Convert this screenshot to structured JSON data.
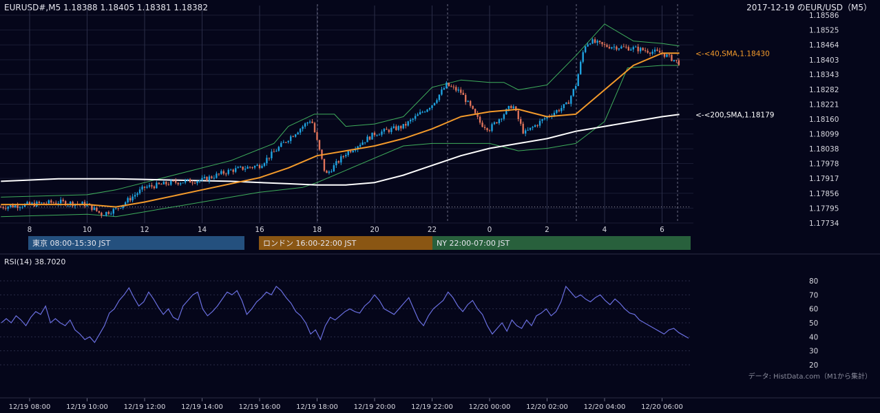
{
  "header": {
    "ohlc": "EURUSD#,M5 1.18388 1.18405 1.18381 1.18382",
    "title": "2017-12-19 のEUR/USD（M5）"
  },
  "sessions": [
    {
      "label": "東京 08:00-15:30 JST",
      "color": "#24507e"
    },
    {
      "label": "ロンドン 16:00-22:00 JST",
      "color": "#8a5613"
    },
    {
      "label": "NY 22:00-07:00 JST",
      "color": "#28603c"
    }
  ],
  "rsi": {
    "label": "RSI(14) 38.7020"
  },
  "source": "データ: HistData.com（M1から集計）",
  "colors": {
    "bg": "#05061a",
    "up": "#1fa3e0",
    "down": "#e0735a",
    "sma40": "#f39a2b",
    "sma200": "#ffffff",
    "bb": "#3fae5c",
    "rsi": "#6a6fe0"
  },
  "chart_data": [
    {
      "type": "candlestick",
      "title": "2017-12-19 のEUR/USD（M5）",
      "y_ticks": [
        "1.18586",
        "1.18525",
        "1.18464",
        "1.18403",
        "1.18343",
        "1.18282",
        "1.18221",
        "1.18160",
        "1.18099",
        "1.18038",
        "1.17978",
        "1.17917",
        "1.17856",
        "1.17795",
        "1.17734"
      ],
      "ylim": [
        1.17734,
        1.18586
      ],
      "x_ticks": [
        "8",
        "10",
        "12",
        "14",
        "16",
        "18",
        "20",
        "22",
        "0",
        "2",
        "4",
        "6"
      ],
      "bottom_time_labels": [
        "12/19 08:00",
        "12/19 10:00",
        "12/19 12:00",
        "12/19 14:00",
        "12/19 16:00",
        "12/19 18:00",
        "12/19 20:00",
        "12/19 22:00",
        "12/20 00:00",
        "12/20 02:00",
        "12/20 04:00",
        "12/20 06:00"
      ],
      "annotations": [
        {
          "text": "<-<40,SMA,1.18430",
          "value": 1.1843,
          "color": "#f39a2b"
        },
        {
          "text": "<-<200,SMA,1.18179",
          "value": 1.18179,
          "color": "#ffffff"
        }
      ],
      "series": {
        "close_keypoints": [
          {
            "t": 7.0,
            "v": 1.178
          },
          {
            "t": 8.0,
            "v": 1.1781
          },
          {
            "t": 9.0,
            "v": 1.1782
          },
          {
            "t": 10.0,
            "v": 1.1781
          },
          {
            "t": 10.5,
            "v": 1.1777
          },
          {
            "t": 11.0,
            "v": 1.1779
          },
          {
            "t": 12.0,
            "v": 1.1788
          },
          {
            "t": 13.0,
            "v": 1.179
          },
          {
            "t": 14.0,
            "v": 1.1791
          },
          {
            "t": 15.0,
            "v": 1.1795
          },
          {
            "t": 16.0,
            "v": 1.1797
          },
          {
            "t": 17.0,
            "v": 1.1808
          },
          {
            "t": 17.8,
            "v": 1.1816
          },
          {
            "t": 18.3,
            "v": 1.1793
          },
          {
            "t": 19.0,
            "v": 1.1802
          },
          {
            "t": 20.0,
            "v": 1.181
          },
          {
            "t": 21.0,
            "v": 1.1813
          },
          {
            "t": 22.0,
            "v": 1.1822
          },
          {
            "t": 22.5,
            "v": 1.183
          },
          {
            "t": 23.0,
            "v": 1.1827
          },
          {
            "t": 23.7,
            "v": 1.1814
          },
          {
            "t": 24.0,
            "v": 1.1812
          },
          {
            "t": 24.8,
            "v": 1.1822
          },
          {
            "t": 25.2,
            "v": 1.181
          },
          {
            "t": 26.0,
            "v": 1.1817
          },
          {
            "t": 26.7,
            "v": 1.1822
          },
          {
            "t": 27.0,
            "v": 1.183
          },
          {
            "t": 27.3,
            "v": 1.1846
          },
          {
            "t": 27.5,
            "v": 1.1848
          },
          {
            "t": 28.0,
            "v": 1.1846
          },
          {
            "t": 29.0,
            "v": 1.1845
          },
          {
            "t": 30.0,
            "v": 1.1843
          },
          {
            "t": 30.6,
            "v": 1.1839
          }
        ],
        "sma40": [
          {
            "t": 7.0,
            "v": 1.1781
          },
          {
            "t": 10.0,
            "v": 1.1781
          },
          {
            "t": 11.0,
            "v": 1.178
          },
          {
            "t": 12.0,
            "v": 1.1782
          },
          {
            "t": 14.0,
            "v": 1.1787
          },
          {
            "t": 16.0,
            "v": 1.1792
          },
          {
            "t": 17.0,
            "v": 1.1796
          },
          {
            "t": 18.0,
            "v": 1.1801
          },
          {
            "t": 19.0,
            "v": 1.1803
          },
          {
            "t": 20.0,
            "v": 1.1805
          },
          {
            "t": 21.0,
            "v": 1.1808
          },
          {
            "t": 22.0,
            "v": 1.1812
          },
          {
            "t": 23.0,
            "v": 1.1817
          },
          {
            "t": 24.0,
            "v": 1.1819
          },
          {
            "t": 25.0,
            "v": 1.182
          },
          {
            "t": 26.0,
            "v": 1.1817
          },
          {
            "t": 27.0,
            "v": 1.1818
          },
          {
            "t": 28.0,
            "v": 1.1828
          },
          {
            "t": 29.0,
            "v": 1.1838
          },
          {
            "t": 30.0,
            "v": 1.1843
          },
          {
            "t": 30.6,
            "v": 1.1843
          }
        ],
        "sma200": [
          {
            "t": 7.0,
            "v": 1.17905
          },
          {
            "t": 9.0,
            "v": 1.17915
          },
          {
            "t": 11.0,
            "v": 1.17915
          },
          {
            "t": 13.0,
            "v": 1.1791
          },
          {
            "t": 15.0,
            "v": 1.17905
          },
          {
            "t": 17.0,
            "v": 1.17895
          },
          {
            "t": 18.0,
            "v": 1.1789
          },
          {
            "t": 19.0,
            "v": 1.1789
          },
          {
            "t": 20.0,
            "v": 1.179
          },
          {
            "t": 21.0,
            "v": 1.1793
          },
          {
            "t": 22.0,
            "v": 1.1797
          },
          {
            "t": 23.0,
            "v": 1.1801
          },
          {
            "t": 24.0,
            "v": 1.1804
          },
          {
            "t": 25.0,
            "v": 1.1806
          },
          {
            "t": 26.0,
            "v": 1.1808
          },
          {
            "t": 27.0,
            "v": 1.1811
          },
          {
            "t": 28.0,
            "v": 1.1813
          },
          {
            "t": 29.0,
            "v": 1.1815
          },
          {
            "t": 30.0,
            "v": 1.1817
          },
          {
            "t": 30.6,
            "v": 1.18179
          }
        ],
        "bb_upper": [
          {
            "t": 7.0,
            "v": 1.1784
          },
          {
            "t": 10.0,
            "v": 1.1785
          },
          {
            "t": 11.0,
            "v": 1.1787
          },
          {
            "t": 13.0,
            "v": 1.1793
          },
          {
            "t": 15.0,
            "v": 1.1799
          },
          {
            "t": 16.5,
            "v": 1.1806
          },
          {
            "t": 17.0,
            "v": 1.1813
          },
          {
            "t": 17.9,
            "v": 1.1818
          },
          {
            "t": 18.6,
            "v": 1.1818
          },
          {
            "t": 19.0,
            "v": 1.1813
          },
          {
            "t": 20.0,
            "v": 1.1814
          },
          {
            "t": 21.0,
            "v": 1.1817
          },
          {
            "t": 22.0,
            "v": 1.1829
          },
          {
            "t": 23.0,
            "v": 1.1832
          },
          {
            "t": 24.0,
            "v": 1.1831
          },
          {
            "t": 24.5,
            "v": 1.1831
          },
          {
            "t": 25.0,
            "v": 1.1828
          },
          {
            "t": 26.0,
            "v": 1.183
          },
          {
            "t": 27.0,
            "v": 1.1842
          },
          {
            "t": 28.0,
            "v": 1.1855
          },
          {
            "t": 29.0,
            "v": 1.1848
          },
          {
            "t": 30.0,
            "v": 1.1847
          },
          {
            "t": 30.6,
            "v": 1.1846
          }
        ],
        "bb_lower": [
          {
            "t": 7.0,
            "v": 1.1776
          },
          {
            "t": 10.0,
            "v": 1.1777
          },
          {
            "t": 11.0,
            "v": 1.1776
          },
          {
            "t": 12.0,
            "v": 1.1778
          },
          {
            "t": 14.0,
            "v": 1.1782
          },
          {
            "t": 16.0,
            "v": 1.1786
          },
          {
            "t": 17.5,
            "v": 1.1788
          },
          {
            "t": 18.0,
            "v": 1.179
          },
          {
            "t": 19.0,
            "v": 1.1795
          },
          {
            "t": 20.0,
            "v": 1.18
          },
          {
            "t": 21.0,
            "v": 1.1805
          },
          {
            "t": 22.0,
            "v": 1.1806
          },
          {
            "t": 23.0,
            "v": 1.1806
          },
          {
            "t": 24.0,
            "v": 1.1806
          },
          {
            "t": 25.0,
            "v": 1.1803
          },
          {
            "t": 26.0,
            "v": 1.1804
          },
          {
            "t": 27.0,
            "v": 1.1806
          },
          {
            "t": 28.0,
            "v": 1.1815
          },
          {
            "t": 28.8,
            "v": 1.1837
          },
          {
            "t": 30.0,
            "v": 1.1838
          },
          {
            "t": 30.6,
            "v": 1.1838
          }
        ]
      }
    },
    {
      "type": "line",
      "title": "RSI(14) 38.7020",
      "y_ticks": [
        "80",
        "70",
        "60",
        "50",
        "40",
        "30",
        "20"
      ],
      "ylim": [
        20,
        80
      ],
      "series": [
        {
          "values": [
            50,
            53,
            50,
            55,
            52,
            48,
            54,
            58,
            56,
            62,
            50,
            53,
            50,
            48,
            52,
            45,
            42,
            38,
            40,
            36,
            42,
            48,
            57,
            60,
            66,
            70,
            75,
            68,
            62,
            65,
            72,
            67,
            61,
            56,
            60,
            54,
            52,
            62,
            66,
            70,
            72,
            60,
            55,
            58,
            62,
            67,
            72,
            70,
            73,
            66,
            56,
            60,
            65,
            68,
            72,
            70,
            76,
            73,
            68,
            64,
            58,
            55,
            50,
            42,
            45,
            38,
            48,
            54,
            52,
            55,
            58,
            60,
            58,
            57,
            62,
            65,
            70,
            66,
            60,
            58,
            56,
            60,
            64,
            68,
            60,
            52,
            48,
            55,
            60,
            63,
            66,
            72,
            68,
            62,
            58,
            63,
            66,
            60,
            56,
            48,
            42,
            46,
            50,
            44,
            52,
            48,
            46,
            52,
            48,
            55,
            57,
            60,
            55,
            58,
            65,
            76,
            72,
            68,
            70,
            67,
            65,
            68,
            70,
            66,
            63,
            67,
            64,
            60,
            57,
            56,
            52,
            50,
            48,
            46,
            44,
            42,
            45,
            46,
            43,
            41,
            39
          ]
        }
      ]
    }
  ]
}
